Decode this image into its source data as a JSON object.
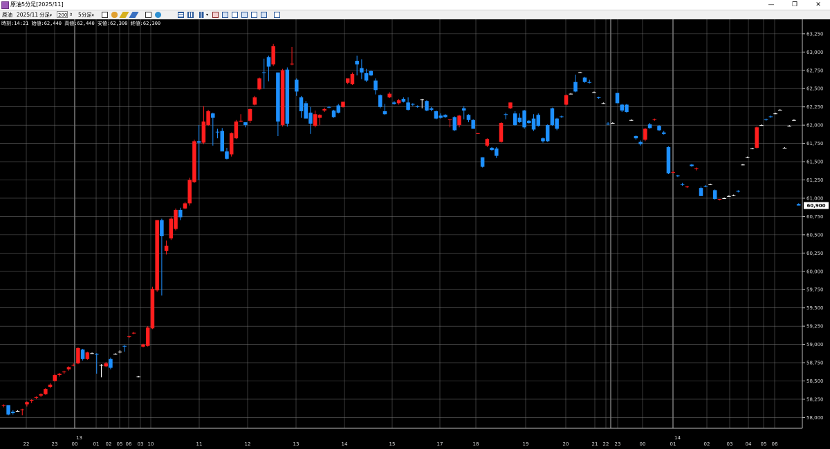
{
  "window": {
    "title": "原油5分足[2025/11]",
    "controls": [
      "—",
      "❐",
      "✕"
    ]
  },
  "toolbar": {
    "symbol": "原油",
    "contract": "2025/11",
    "period_unit": "分足",
    "bar_count": "200",
    "interval": "5分足"
  },
  "info": {
    "text": "時刻:14:21 始値:62,440 高値:62,440 安値:62,300 終値:62,300"
  },
  "colors": {
    "up": "#ff1e1e",
    "down": "#1e90ff",
    "flat": "#ffffff",
    "grid": "#7a7a7a",
    "background": "#000000"
  },
  "chart_data": {
    "type": "candlestick",
    "ylim": [
      57900,
      63400
    ],
    "y_ticks": [
      "63,250",
      "63,000",
      "62,750",
      "62,500",
      "62,250",
      "62,000",
      "61,750",
      "61,500",
      "61,250",
      "61,000",
      "60,750",
      "60,500",
      "60,250",
      "60,000",
      "59,750",
      "59,500",
      "59,250",
      "59,000",
      "58,750",
      "58,500",
      "58,250",
      "58,000"
    ],
    "x_labels": [
      "22",
      "23",
      "00",
      "01",
      "02",
      "05",
      "06",
      "03",
      "10",
      "11",
      "12",
      "13",
      "14",
      "15",
      "17",
      "18",
      "19",
      "20",
      "21",
      "22",
      "23",
      "00",
      "01",
      "02",
      "03",
      "04",
      "05",
      "06"
    ],
    "date_labels": [
      "13",
      "14"
    ],
    "current_price": "60,900",
    "candles": [
      [
        58160,
        58180,
        58140,
        58170
      ],
      [
        58170,
        58170,
        58030,
        58040
      ],
      [
        58080,
        58100,
        58040,
        58060
      ],
      [
        58090,
        58100,
        58080,
        58090
      ],
      [
        58100,
        58120,
        58030,
        58110
      ],
      [
        58180,
        58220,
        58150,
        58210
      ],
      [
        58230,
        58250,
        58200,
        58240
      ],
      [
        58270,
        58290,
        58250,
        58280
      ],
      [
        58300,
        58330,
        58280,
        58320
      ],
      [
        58320,
        58400,
        58310,
        58390
      ],
      [
        58420,
        58470,
        58400,
        58450
      ],
      [
        58500,
        58600,
        58490,
        58580
      ],
      [
        58580,
        58610,
        58560,
        58600
      ],
      [
        58620,
        58640,
        58600,
        58630
      ],
      [
        58660,
        58700,
        58640,
        58690
      ],
      [
        58710,
        58740,
        58700,
        58720
      ],
      [
        58740,
        58960,
        58730,
        58950
      ],
      [
        58930,
        58940,
        58780,
        58800
      ],
      [
        58800,
        58900,
        58790,
        58890
      ],
      [
        58880,
        58890,
        58870,
        58880
      ],
      [
        58870,
        58880,
        58600,
        58860
      ],
      [
        58720,
        58730,
        58550,
        58720
      ],
      [
        58700,
        58760,
        58690,
        58740
      ],
      [
        58800,
        58820,
        58660,
        58680
      ],
      [
        58870,
        58880,
        58860,
        58870
      ],
      [
        58900,
        58920,
        58880,
        58900
      ],
      [
        58980,
        58990,
        58900,
        58970
      ],
      [
        59100,
        59120,
        59090,
        59110
      ],
      [
        59150,
        59170,
        59140,
        59160
      ],
      [
        58560,
        58570,
        58550,
        58560
      ],
      [
        58970,
        59010,
        58960,
        59000
      ],
      [
        58980,
        59250,
        58970,
        59230
      ],
      [
        59220,
        59790,
        59210,
        59760
      ],
      [
        59740,
        60700,
        59720,
        60700
      ],
      [
        60700,
        60720,
        59670,
        60480
      ],
      [
        60280,
        60420,
        60230,
        60350
      ],
      [
        60450,
        60740,
        60430,
        60720
      ],
      [
        60580,
        60860,
        60560,
        60840
      ],
      [
        60840,
        60870,
        60700,
        60740
      ],
      [
        60860,
        60950,
        60850,
        60930
      ],
      [
        60930,
        61280,
        60900,
        61250
      ],
      [
        61220,
        61800,
        61210,
        61780
      ],
      [
        61780,
        62000,
        61250,
        61760
      ],
      [
        61760,
        62260,
        61740,
        62050
      ],
      [
        62000,
        62210,
        61990,
        62190
      ],
      [
        62160,
        62170,
        61720,
        62100
      ],
      [
        61910,
        61950,
        61820,
        61900
      ],
      [
        61920,
        61960,
        61650,
        61640
      ],
      [
        61640,
        61690,
        61530,
        61540
      ],
      [
        61600,
        61900,
        61570,
        61890
      ],
      [
        61820,
        62070,
        61810,
        62050
      ],
      [
        62050,
        62150,
        62040,
        62060
      ],
      [
        62040,
        62040,
        61970,
        62000
      ],
      [
        62060,
        62230,
        62030,
        62220
      ],
      [
        62280,
        62400,
        62270,
        62380
      ],
      [
        62490,
        62650,
        62480,
        62640
      ],
      [
        62720,
        62910,
        62500,
        62710
      ],
      [
        62930,
        62950,
        62600,
        62800
      ],
      [
        62830,
        63110,
        62810,
        63080
      ],
      [
        62720,
        62720,
        61850,
        62050
      ],
      [
        62000,
        62770,
        61980,
        62750
      ],
      [
        62760,
        62790,
        61980,
        62020
      ],
      [
        62830,
        63070,
        62820,
        62840
      ],
      [
        62620,
        62640,
        62400,
        62460
      ],
      [
        62380,
        62400,
        62100,
        62190
      ],
      [
        62300,
        62330,
        62180,
        62090
      ],
      [
        62170,
        62250,
        61880,
        62020
      ],
      [
        61990,
        62200,
        61970,
        62150
      ],
      [
        62100,
        62150,
        62000,
        62140
      ],
      [
        62200,
        62240,
        62180,
        62220
      ],
      [
        62250,
        62260,
        62230,
        62240
      ],
      [
        62200,
        62210,
        62100,
        62110
      ],
      [
        62270,
        62290,
        62160,
        62170
      ],
      [
        62250,
        62320,
        62240,
        62320
      ],
      [
        62580,
        62630,
        62560,
        62640
      ],
      [
        62560,
        62720,
        62550,
        62700
      ],
      [
        62880,
        62950,
        62680,
        62830
      ],
      [
        62780,
        62900,
        62630,
        62720
      ],
      [
        62710,
        62770,
        62590,
        62610
      ],
      [
        62740,
        62750,
        62670,
        62680
      ],
      [
        62610,
        62640,
        62420,
        62480
      ],
      [
        62410,
        62420,
        62230,
        62250
      ],
      [
        62190,
        62290,
        62140,
        62150
      ],
      [
        62380,
        62450,
        62370,
        62430
      ],
      [
        62310,
        62330,
        62280,
        62290
      ],
      [
        62300,
        62360,
        62280,
        62340
      ],
      [
        62360,
        62380,
        62310,
        62320
      ],
      [
        62310,
        62380,
        62200,
        62210
      ],
      [
        62290,
        62300,
        62260,
        62280
      ],
      [
        62260,
        62270,
        62240,
        62250
      ],
      [
        62350,
        62360,
        62230,
        62350
      ],
      [
        62330,
        62340,
        62190,
        62200
      ],
      [
        62230,
        62250,
        62190,
        62210
      ],
      [
        62190,
        62200,
        62080,
        62090
      ],
      [
        62130,
        62160,
        62090,
        62100
      ],
      [
        62140,
        62150,
        62100,
        62110
      ],
      [
        62070,
        62080,
        61970,
        62080
      ],
      [
        62110,
        62120,
        61920,
        61930
      ],
      [
        62000,
        62140,
        61970,
        62130
      ],
      [
        62230,
        62260,
        62080,
        62200
      ],
      [
        62140,
        62150,
        62040,
        62070
      ],
      [
        62070,
        62080,
        61950,
        61950
      ],
      [
        61880,
        61890,
        61880,
        61890
      ],
      [
        61560,
        61560,
        61420,
        61430
      ],
      [
        61720,
        61820,
        61700,
        61810
      ],
      [
        61690,
        61700,
        61650,
        61660
      ],
      [
        61680,
        61700,
        61550,
        61580
      ],
      [
        61770,
        62040,
        61760,
        62030
      ],
      [
        62150,
        62170,
        62080,
        62140
      ],
      [
        62230,
        62310,
        62220,
        62310
      ],
      [
        62160,
        62190,
        61990,
        62000
      ],
      [
        62100,
        62160,
        62030,
        62040
      ],
      [
        62200,
        62210,
        61950,
        61970
      ],
      [
        62060,
        62070,
        62020,
        62030
      ],
      [
        62090,
        62150,
        61920,
        61940
      ],
      [
        62140,
        62160,
        61980,
        61990
      ],
      [
        61820,
        61830,
        61760,
        61780
      ],
      [
        62000,
        62010,
        61770,
        61780
      ],
      [
        62230,
        62240,
        61990,
        62000
      ],
      [
        62090,
        62100,
        61930,
        61950
      ],
      [
        62120,
        62130,
        62100,
        62110
      ],
      [
        62280,
        62420,
        62270,
        62410
      ],
      [
        62430,
        62440,
        62420,
        62430
      ],
      [
        62590,
        62690,
        62450,
        62460
      ],
      [
        62720,
        62730,
        62710,
        62720
      ],
      [
        62650,
        62660,
        62580,
        62590
      ],
      [
        62590,
        62620,
        62570,
        62580
      ],
      [
        62450,
        62460,
        62440,
        62450
      ],
      [
        62380,
        62390,
        62360,
        62370
      ],
      [
        62300,
        62310,
        62290,
        62300
      ],
      [
        62020,
        62040,
        62000,
        62010
      ],
      [
        62030,
        62040,
        62020,
        62030
      ],
      [
        62440,
        62440,
        62300,
        62300
      ],
      [
        62280,
        62290,
        62180,
        62200
      ],
      [
        62280,
        62290,
        62170,
        62180
      ],
      [
        62070,
        62080,
        62060,
        62070
      ],
      [
        61850,
        61860,
        61800,
        61820
      ],
      [
        61770,
        61790,
        61720,
        61740
      ],
      [
        61800,
        61960,
        61780,
        61950
      ],
      [
        62010,
        62030,
        61950,
        61960
      ],
      [
        62070,
        62090,
        62060,
        62080
      ],
      [
        61990,
        62000,
        61920,
        61930
      ],
      [
        61900,
        61920,
        61870,
        61880
      ],
      [
        61700,
        61710,
        61330,
        61340
      ],
      [
        61350,
        61370,
        61340,
        61360
      ],
      [
        61310,
        61320,
        61290,
        61300
      ],
      [
        61190,
        61210,
        61170,
        61180
      ],
      [
        61150,
        61170,
        61140,
        61160
      ],
      [
        61460,
        61470,
        61430,
        61440
      ],
      [
        61400,
        61420,
        61380,
        61410
      ],
      [
        61140,
        61160,
        61030,
        61030
      ],
      [
        61170,
        61180,
        61150,
        61160
      ],
      [
        61190,
        61200,
        61180,
        61190
      ],
      [
        61110,
        61120,
        60980,
        60990
      ],
      [
        60980,
        60990,
        60970,
        60990
      ],
      [
        61000,
        61010,
        60990,
        61000
      ],
      [
        61030,
        61040,
        61020,
        61030
      ],
      [
        61040,
        61050,
        61030,
        61040
      ],
      [
        61100,
        61110,
        61080,
        61090
      ],
      [
        61460,
        61470,
        61450,
        61460
      ],
      [
        61560,
        61570,
        61550,
        61560
      ],
      [
        61680,
        61690,
        61670,
        61680
      ],
      [
        61690,
        61980,
        61680,
        61970
      ],
      [
        62000,
        62010,
        61990,
        62000
      ],
      [
        62080,
        62090,
        62060,
        62070
      ],
      [
        62120,
        62130,
        62100,
        62110
      ],
      [
        62160,
        62170,
        62150,
        62160
      ],
      [
        62210,
        62220,
        62200,
        62210
      ],
      [
        61690,
        61700,
        61680,
        61690
      ],
      [
        61990,
        62000,
        61980,
        61990
      ],
      [
        62070,
        62080,
        62060,
        62070
      ],
      [
        60920,
        60930,
        60900,
        60900
      ]
    ]
  }
}
